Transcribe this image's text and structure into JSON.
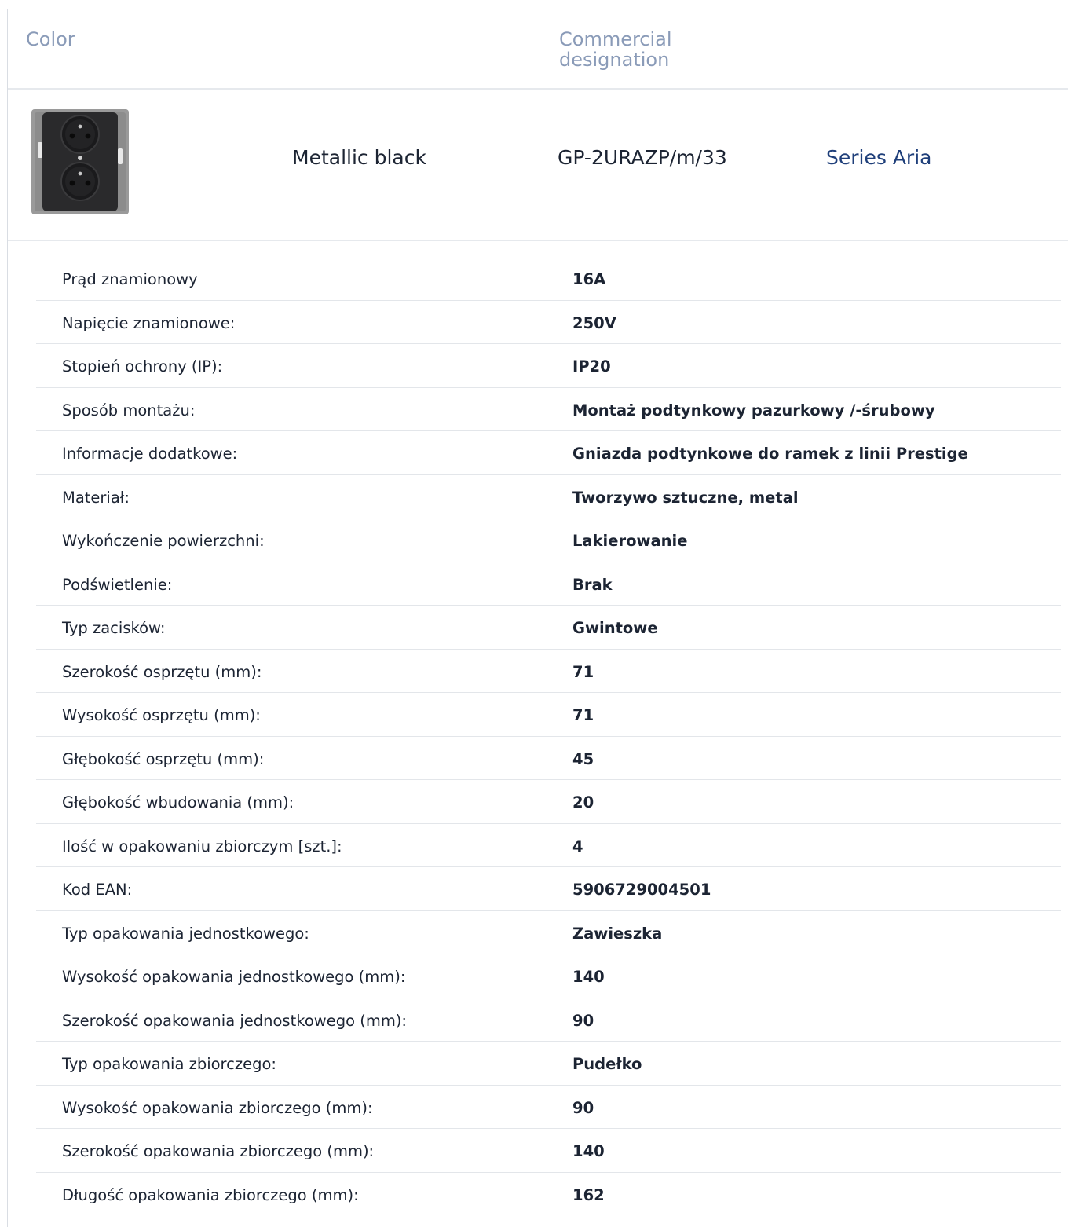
{
  "header": {
    "color_label": "Color",
    "designation_label": "Commercial designation"
  },
  "product": {
    "image_icon": "socket-icon",
    "color": "Metallic black",
    "designation": "GP-2URAZP/m/33",
    "series": "Series Aria"
  },
  "specs": [
    {
      "label": "Prąd znamionowy",
      "value": "16A"
    },
    {
      "label": "Napięcie znamionowe:",
      "value": "250V"
    },
    {
      "label": "Stopień ochrony (IP):",
      "value": "IP20"
    },
    {
      "label": "Sposób montażu:",
      "value": "Montaż podtynkowy pazurkowy /-śrubowy"
    },
    {
      "label": "Informacje dodatkowe:",
      "value": "Gniazda podtynkowe do ramek z linii Prestige"
    },
    {
      "label": "Materiał:",
      "value": "Tworzywo sztuczne, metal"
    },
    {
      "label": "Wykończenie powierzchni:",
      "value": "Lakierowanie"
    },
    {
      "label": "Podświetlenie:",
      "value": "Brak"
    },
    {
      "label": "Typ zacisków:",
      "value": "Gwintowe"
    },
    {
      "label": "Szerokość osprzętu (mm):",
      "value": "71"
    },
    {
      "label": "Wysokość osprzętu (mm):",
      "value": "71"
    },
    {
      "label": "Głębokość osprzętu (mm):",
      "value": "45"
    },
    {
      "label": "Głębokość wbudowania (mm):",
      "value": "20"
    },
    {
      "label": "Ilość w opakowaniu zbiorczym [szt.]:",
      "value": "4"
    },
    {
      "label": "Kod EAN:",
      "value": "5906729004501"
    },
    {
      "label": "Typ opakowania jednostkowego:",
      "value": "Zawieszka"
    },
    {
      "label": "Wysokość opakowania jednostkowego (mm):",
      "value": "140"
    },
    {
      "label": "Szerokość opakowania jednostkowego (mm):",
      "value": "90"
    },
    {
      "label": "Typ opakowania zbiorczego:",
      "value": "Pudełko"
    },
    {
      "label": "Wysokość opakowania zbiorczego (mm):",
      "value": "90"
    },
    {
      "label": "Szerokość opakowania zbiorczego (mm):",
      "value": "140"
    },
    {
      "label": "Długość opakowania zbiorczego (mm):",
      "value": "162"
    }
  ]
}
